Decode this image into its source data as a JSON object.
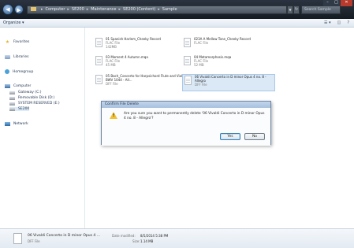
{
  "address": {
    "segments": [
      "Computer",
      "SE200",
      "Maintenance",
      "SE200 (Content)",
      "Sample"
    ],
    "search_placeholder": "Search Sample"
  },
  "window": {
    "minimize": "–",
    "maximize": "□",
    "close": "✕"
  },
  "toolbar": {
    "organize": "Organize ▾",
    "view": "☰ ▾",
    "pane": "◫",
    "help": "?"
  },
  "nav": {
    "favorites": "Favorites",
    "libraries": "Libraries",
    "homegroup": "Homegroup",
    "computer": "Computer",
    "drives": [
      "Gateway (C:)",
      "Removable Disk (D:)",
      "SYSTEM RESERVED (E:)",
      "SE200"
    ],
    "network": "Network"
  },
  "files": [
    {
      "name": "01 Spanish Harlem_Cheeky Record",
      "type": "FLAC File",
      "size": "142MB"
    },
    {
      "name": "023A A Mellow Tone_Cheeky Record",
      "type": "FLAC File",
      "size": ""
    },
    {
      "name": "03 Moment 4 Autumn.mqa",
      "type": "FLAC File",
      "size": "45 MB"
    },
    {
      "name": "04 Metamorphosis.mqa",
      "type": "FLAC File",
      "size": "52 MB"
    },
    {
      "name": "05 Bach_Concerto for Harpsichord Flute and Violin BWV 1044 - All...",
      "type": "DFF File",
      "size": ""
    },
    {
      "name": "06 Vivaldi Concerto in D minor Opus 4 no. 8 - Allegro",
      "type": "DFF File",
      "size": ""
    }
  ],
  "dialog": {
    "title": "Confirm File Delete",
    "message": "Are you sure you want to permanently delete '06 Vivaldi Concerto in D minor Opus 4 no. 8 - Allegro'?",
    "yes": "Yes",
    "no": "No"
  },
  "details": {
    "name": "06 Vivaldi Concerto in D minor Opus 4 ...",
    "type": "DFF File",
    "date_label": "Date modified:",
    "date": "8/5/2014 5:38 PM",
    "size_label": "Size:",
    "size": "1.14 MB"
  }
}
